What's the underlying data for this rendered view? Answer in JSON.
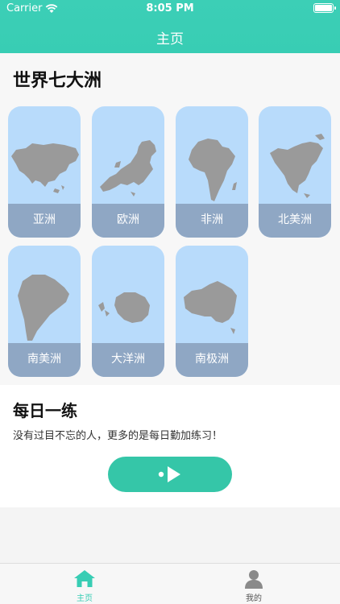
{
  "status_bar": {
    "carrier": "Carrier",
    "time": "8:05 PM"
  },
  "nav": {
    "title": "主页"
  },
  "continents": {
    "title": "世界七大洲",
    "items": [
      {
        "label": "亚洲"
      },
      {
        "label": "欧洲"
      },
      {
        "label": "非洲"
      },
      {
        "label": "北美洲"
      },
      {
        "label": "南美洲"
      },
      {
        "label": "大洋洲"
      },
      {
        "label": "南极洲"
      }
    ]
  },
  "daily": {
    "title": "每日一练",
    "subtitle": "没有过目不忘的人，更多的是每日勤加练习！"
  },
  "tabbar": {
    "home_label": "主页",
    "mine_label": "我的"
  },
  "colors": {
    "accent": "#38cdb4",
    "card_bg": "#b8dbfb",
    "card_label_bg": "#8fa7c4",
    "map_gray": "#9a9a9a"
  }
}
